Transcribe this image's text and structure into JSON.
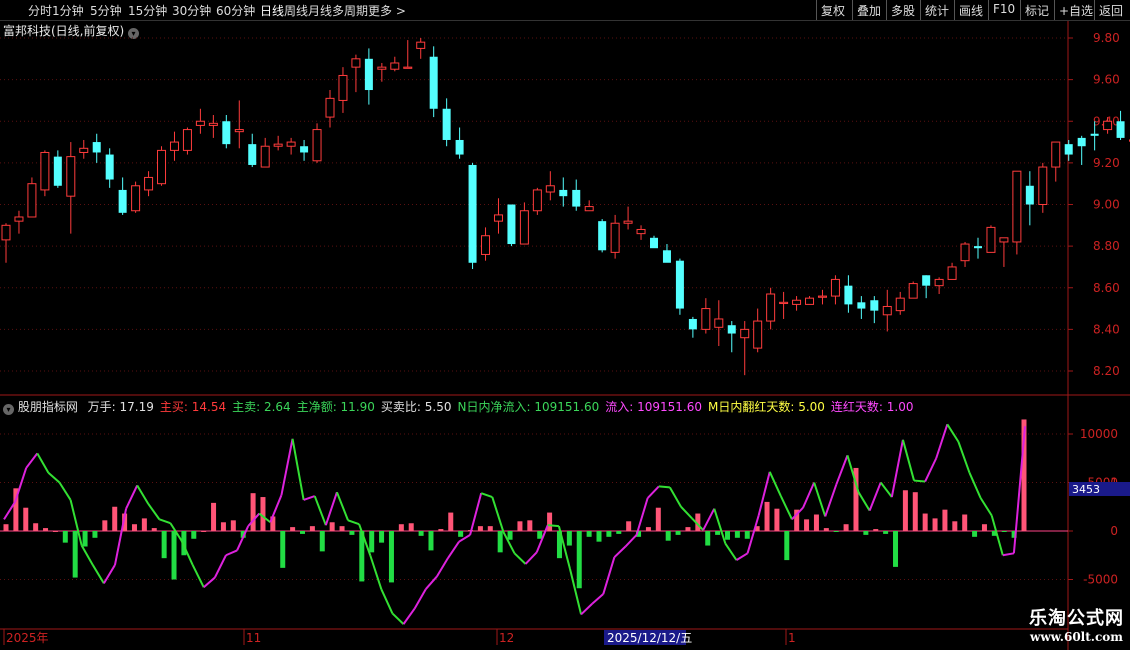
{
  "toolbar": {
    "periods": [
      "分时",
      "1分钟",
      "5分钟",
      "15分钟",
      "30分钟",
      "60分钟",
      "日线",
      "周线",
      "月线",
      "多周期",
      "更多"
    ],
    "active_period": "日线",
    "right_buttons": [
      "复权",
      "叠加",
      "多股",
      "统计",
      "画线",
      "F10",
      "标记",
      "+自选",
      "返回"
    ]
  },
  "stock_title": "富邦科技(日线,前复权)",
  "indicator": {
    "name": "股朋指标网",
    "items": [
      {
        "label": "万手:",
        "value": "17.19",
        "color": "#e0e0e0"
      },
      {
        "label": "主买:",
        "value": "14.54",
        "color": "#ff3b3b"
      },
      {
        "label": "主卖:",
        "value": "2.64",
        "color": "#3bd65a"
      },
      {
        "label": "主净额:",
        "value": "11.90",
        "color": "#3bd65a"
      },
      {
        "label": "买卖比:",
        "value": "5.50",
        "color": "#e0e0e0"
      },
      {
        "label": "N日内净流入:",
        "value": "109151.60",
        "color": "#3bd65a"
      },
      {
        "label": "流入:",
        "value": "109151.60",
        "color": "#ff4aff"
      },
      {
        "label": "M日内翻红天数:",
        "value": "5.00",
        "color": "#ffff44"
      },
      {
        "label": "连红天数:",
        "value": "1.00",
        "color": "#ff4aff"
      }
    ]
  },
  "price_axis": [
    "9.80",
    "9.60",
    "9.40",
    "9.20",
    "9.00",
    "8.80",
    "8.60",
    "8.40",
    "8.20"
  ],
  "indicator_axis": [
    "10000",
    "5000",
    "0",
    "-5000"
  ],
  "indicator_axis_partial": "1",
  "crosshair_value": "3453",
  "date_axis": [
    "2025年",
    "11",
    "12",
    "1"
  ],
  "date_tag": "2025/12/12/五",
  "watermark": {
    "line1": "乐淘公式网",
    "line2": "www.60lt.com"
  },
  "colors": {
    "up": "#ff3c3c",
    "down": "#54ffff",
    "bull_bar": "#ff5577",
    "bear_bar": "#22dd44",
    "line_green": "#33e033",
    "line_magenta": "#dd22dd"
  },
  "chart_data": {
    "type": "candlestick",
    "ylim": [
      8.15,
      9.88
    ],
    "candles": [
      [
        8.83,
        8.9,
        8.72,
        8.91
      ],
      [
        8.92,
        8.94,
        8.86,
        8.97
      ],
      [
        8.94,
        9.1,
        8.95,
        9.13
      ],
      [
        9.07,
        9.25,
        9.04,
        9.26
      ],
      [
        9.23,
        9.09,
        9.08,
        9.26
      ],
      [
        9.04,
        9.23,
        8.86,
        9.3
      ],
      [
        9.25,
        9.27,
        9.22,
        9.31
      ],
      [
        9.3,
        9.25,
        9.2,
        9.34
      ],
      [
        9.24,
        9.12,
        9.08,
        9.27
      ],
      [
        9.07,
        8.96,
        8.95,
        9.13
      ],
      [
        8.97,
        9.09,
        8.96,
        9.11
      ],
      [
        9.07,
        9.13,
        9.04,
        9.16
      ],
      [
        9.1,
        9.26,
        9.09,
        9.28
      ],
      [
        9.26,
        9.3,
        9.21,
        9.35
      ],
      [
        9.26,
        9.36,
        9.24,
        9.37
      ],
      [
        9.38,
        9.4,
        9.34,
        9.46
      ],
      [
        9.38,
        9.39,
        9.32,
        9.43
      ],
      [
        9.4,
        9.29,
        9.27,
        9.43
      ],
      [
        9.35,
        9.36,
        9.27,
        9.5
      ],
      [
        9.29,
        9.19,
        9.18,
        9.34
      ],
      [
        9.18,
        9.28,
        9.18,
        9.32
      ],
      [
        9.28,
        9.29,
        9.26,
        9.33
      ],
      [
        9.28,
        9.3,
        9.24,
        9.32
      ],
      [
        9.28,
        9.25,
        9.21,
        9.31
      ],
      [
        9.21,
        9.36,
        9.2,
        9.39
      ],
      [
        9.42,
        9.51,
        9.37,
        9.55
      ],
      [
        9.5,
        9.62,
        9.44,
        9.66
      ],
      [
        9.66,
        9.7,
        9.54,
        9.72
      ],
      [
        9.7,
        9.55,
        9.48,
        9.75
      ],
      [
        9.65,
        9.66,
        9.59,
        9.68
      ],
      [
        9.65,
        9.68,
        9.64,
        9.71
      ],
      [
        9.66,
        9.66,
        9.66,
        9.79
      ],
      [
        9.75,
        9.78,
        9.7,
        9.8
      ],
      [
        9.71,
        9.46,
        9.42,
        9.76
      ],
      [
        9.46,
        9.31,
        9.28,
        9.51
      ],
      [
        9.31,
        9.24,
        9.22,
        9.37
      ],
      [
        9.19,
        8.72,
        8.69,
        9.2
      ],
      [
        8.76,
        8.85,
        8.73,
        8.89
      ],
      [
        8.92,
        8.95,
        8.86,
        9.03
      ],
      [
        9.0,
        8.81,
        8.8,
        9.0
      ],
      [
        8.81,
        8.97,
        8.82,
        9.01
      ],
      [
        8.97,
        9.07,
        8.95,
        9.08
      ],
      [
        9.06,
        9.09,
        9.02,
        9.16
      ],
      [
        9.07,
        9.04,
        8.99,
        9.13
      ],
      [
        9.07,
        8.99,
        8.97,
        9.12
      ],
      [
        8.97,
        8.99,
        8.99,
        9.02
      ],
      [
        8.92,
        8.78,
        8.77,
        8.93
      ],
      [
        8.77,
        8.91,
        8.74,
        8.95
      ],
      [
        8.91,
        8.92,
        8.88,
        8.99
      ],
      [
        8.86,
        8.88,
        8.83,
        8.9
      ],
      [
        8.84,
        8.79,
        8.8,
        8.85
      ],
      [
        8.78,
        8.72,
        8.73,
        8.81
      ],
      [
        8.73,
        8.5,
        8.47,
        8.74
      ],
      [
        8.45,
        8.4,
        8.36,
        8.46
      ],
      [
        8.4,
        8.5,
        8.38,
        8.55
      ],
      [
        8.41,
        8.45,
        8.32,
        8.54
      ],
      [
        8.42,
        8.38,
        8.29,
        8.44
      ],
      [
        8.36,
        8.4,
        8.18,
        8.44
      ],
      [
        8.31,
        8.44,
        8.29,
        8.5
      ],
      [
        8.44,
        8.57,
        8.4,
        8.6
      ],
      [
        8.53,
        8.53,
        8.45,
        8.58
      ],
      [
        8.52,
        8.54,
        8.49,
        8.56
      ],
      [
        8.52,
        8.55,
        8.52,
        8.56
      ],
      [
        8.56,
        8.56,
        8.52,
        8.59
      ],
      [
        8.56,
        8.64,
        8.52,
        8.66
      ],
      [
        8.61,
        8.52,
        8.48,
        8.66
      ],
      [
        8.53,
        8.5,
        8.45,
        8.56
      ],
      [
        8.54,
        8.49,
        8.43,
        8.56
      ],
      [
        8.47,
        8.51,
        8.39,
        8.59
      ],
      [
        8.49,
        8.55,
        8.47,
        8.58
      ],
      [
        8.55,
        8.62,
        8.55,
        8.63
      ],
      [
        8.66,
        8.61,
        8.55,
        8.66
      ],
      [
        8.61,
        8.64,
        8.57,
        8.65
      ],
      [
        8.64,
        8.7,
        8.66,
        8.72
      ],
      [
        8.73,
        8.81,
        8.7,
        8.82
      ],
      [
        8.8,
        8.79,
        8.74,
        8.84
      ],
      [
        8.77,
        8.89,
        8.81,
        8.9
      ],
      [
        8.82,
        8.84,
        8.7,
        8.84
      ],
      [
        8.82,
        9.16,
        8.76,
        9.16
      ],
      [
        9.09,
        9.0,
        8.9,
        9.16
      ],
      [
        9.0,
        9.18,
        8.96,
        9.2
      ],
      [
        9.18,
        9.3,
        9.11,
        9.3
      ],
      [
        9.29,
        9.24,
        9.21,
        9.31
      ],
      [
        9.32,
        9.28,
        9.19,
        9.33
      ],
      [
        9.34,
        9.33,
        9.26,
        9.4
      ],
      [
        9.36,
        9.4,
        9.34,
        9.42
      ],
      [
        9.4,
        9.32,
        9.31,
        9.45
      ],
      [
        9.31,
        9.31,
        9.3,
        9.35
      ],
      [
        9.27,
        9.27,
        9.18,
        9.42
      ],
      [
        9.24,
        9.24,
        9.12,
        9.44
      ],
      [
        9.17,
        9.27,
        9.16,
        9.31
      ],
      [
        9.31,
        9.47,
        9.25,
        9.55
      ]
    ],
    "indicator": {
      "ylim": [
        -10000,
        13000
      ],
      "bars": [
        700,
        4400,
        2400,
        800,
        300,
        0,
        -1200,
        -4800,
        -1600,
        -700,
        1100,
        2500,
        1800,
        700,
        1300,
        300,
        -2800,
        -5000,
        -2500,
        -800,
        0,
        2900,
        900,
        1100,
        -700,
        3900,
        3500,
        1500,
        -3800,
        400,
        -300,
        500,
        -2100,
        900,
        500,
        -400,
        -5200,
        -2200,
        -1200,
        -5300,
        700,
        800,
        -500,
        -2000,
        200,
        1900,
        -600,
        100,
        500,
        500,
        -2200,
        -900,
        1000,
        1100,
        -800,
        1900,
        -2800,
        -1500,
        -5900,
        -600,
        -1100,
        -600,
        -300,
        1000,
        -600,
        400,
        2400,
        -1000,
        -400,
        400,
        1800,
        -1500,
        -400,
        -900,
        -700,
        -800,
        500,
        3000,
        2300,
        -3000,
        2200,
        1200,
        1700,
        300,
        -100,
        700,
        6500,
        -400,
        200,
        -300,
        -3700,
        4200,
        4000,
        1800,
        1300,
        2200,
        1000,
        1700,
        -600,
        700,
        -500,
        -100,
        -700,
        11500
      ],
      "green_line": [
        1200,
        3000,
        6500,
        8000,
        6000,
        5000,
        3200,
        -1500,
        -3500,
        -5400,
        -3500,
        2300,
        4700,
        2800,
        1200,
        800,
        -1000,
        -3500,
        -5800,
        -4800,
        -2500,
        -2000,
        500,
        1800,
        900,
        3700,
        9500,
        3200,
        3600,
        600,
        4000,
        1100,
        700,
        -2500,
        -6000,
        -8500,
        -9600,
        -8000,
        -6000,
        -4700,
        -2800,
        -1100,
        -400,
        3900,
        3500,
        -100,
        -2300,
        -3400,
        -2200,
        600,
        500,
        -3900,
        -8600,
        -7500,
        -6500,
        -2700,
        -1600,
        -400,
        3400,
        4600,
        4500,
        2500,
        1300,
        100,
        2300,
        -1300,
        -3000,
        -2300,
        1600,
        6100,
        3600,
        1200,
        2400,
        5000,
        1500,
        4800,
        7800,
        4000,
        2100,
        5000,
        3500,
        9400,
        5200,
        5100,
        7500,
        11000,
        9200,
        6000,
        3400,
        1600,
        -2500,
        -2300,
        10800
      ],
      "magenta_from": 0
    }
  }
}
